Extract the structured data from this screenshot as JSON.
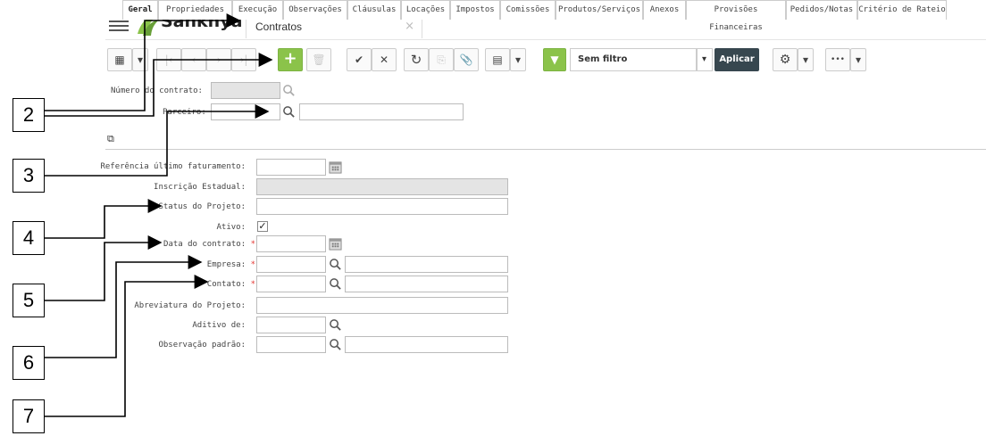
{
  "app": {
    "brand": "Sankhya",
    "brand_color": "#8bc34a"
  },
  "tab": {
    "title": "Contratos",
    "close": "×"
  },
  "toolbar": {
    "filter_value": "Sem filtro",
    "apply_label": "Aplicar",
    "more_label": "•••"
  },
  "header_fields": {
    "contract_number_label": "Número do contrato:",
    "partner_label": "Parceiro:",
    "required_mark": "*"
  },
  "tabs": [
    "Geral",
    "Propriedades",
    "Execução",
    "Observações",
    "Cláusulas",
    "Locações",
    "Impostos",
    "Comissões",
    "Produtos/Serviços",
    "Anexos",
    "Provisões Financeiras",
    "Pedidos/Notas",
    "Critério de Rateio"
  ],
  "form": {
    "ref_billing_label": "Referência último faturamento:",
    "state_reg_label": "Inscrição Estadual:",
    "project_status_label": "Status do Projeto:",
    "active_label": "Ativo:",
    "active_check": "✓",
    "contract_date_label": "Data do contrato:",
    "company_label": "Empresa:",
    "contact_label": "Contato:",
    "project_abbr_label": "Abreviatura do Projeto:",
    "addendum_label": "Aditivo de:",
    "default_note_label": "Observação padrão:"
  },
  "callouts": [
    "2",
    "3",
    "4",
    "5",
    "6",
    "7"
  ]
}
